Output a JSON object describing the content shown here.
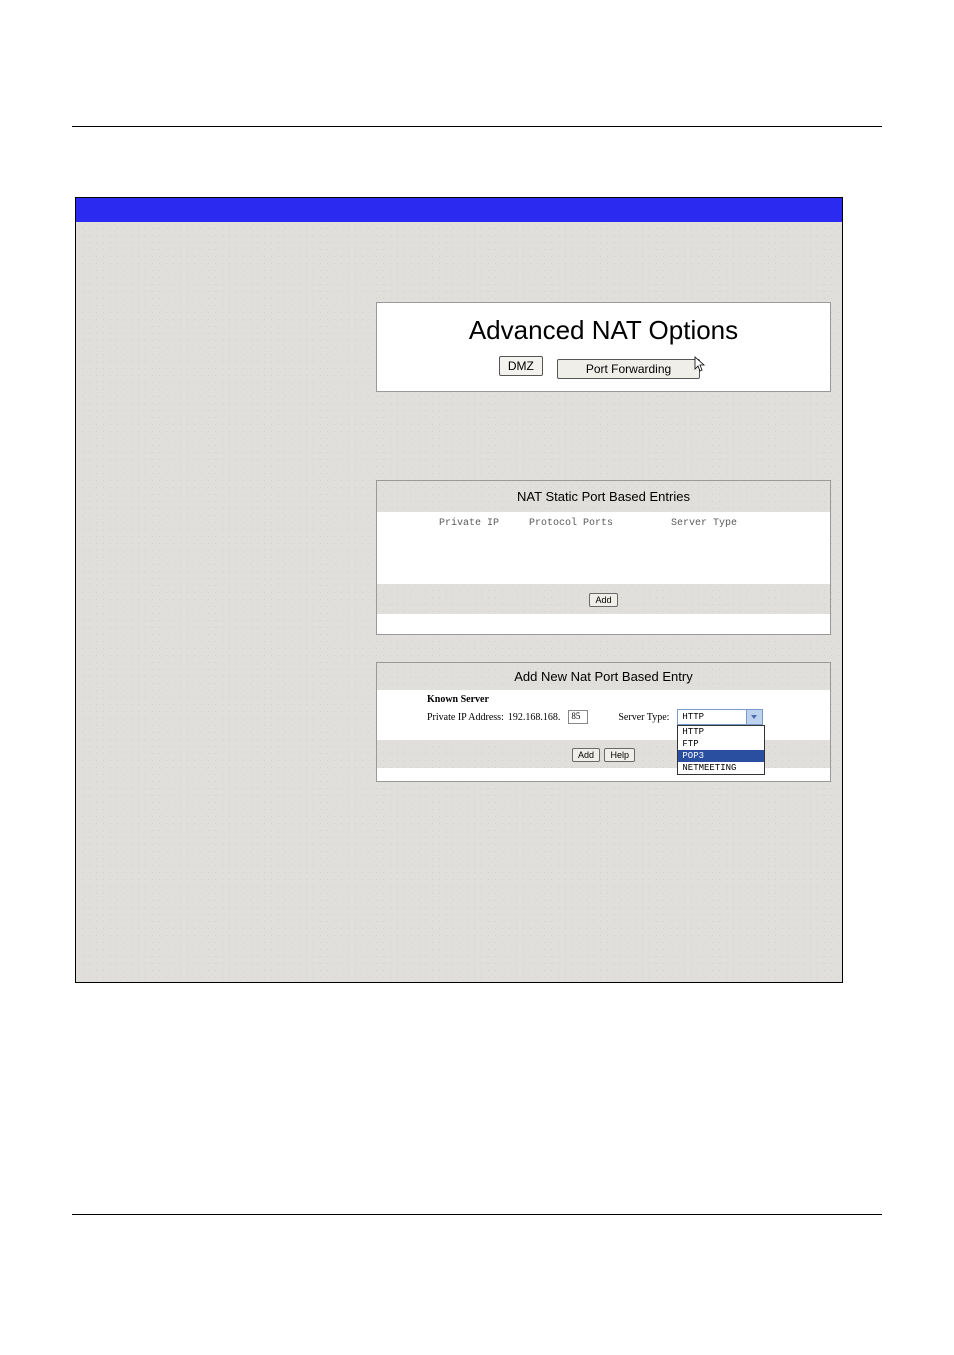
{
  "panel1": {
    "title": "Advanced NAT Options",
    "tab_dmz": "DMZ",
    "tab_pf": "Port Forwarding"
  },
  "panel2": {
    "title": "NAT Static Port Based Entries",
    "col_private_ip": "Private IP",
    "col_protocol_ports": "Protocol Ports",
    "col_server_type": "Server Type",
    "add_btn": "Add"
  },
  "panel3": {
    "title": "Add New Nat Port Based Entry",
    "known_server": "Known Server",
    "private_ip_label": "Private IP Address:",
    "ip_prefix": "192.168.168.",
    "ip_last": "85",
    "server_type_label": "Server Type:",
    "selected": "HTTP",
    "options": [
      "HTTP",
      "FTP",
      "POP3",
      "NETMEETING"
    ],
    "highlighted_index": 2,
    "add_btn": "Add",
    "help_btn": "Help"
  }
}
